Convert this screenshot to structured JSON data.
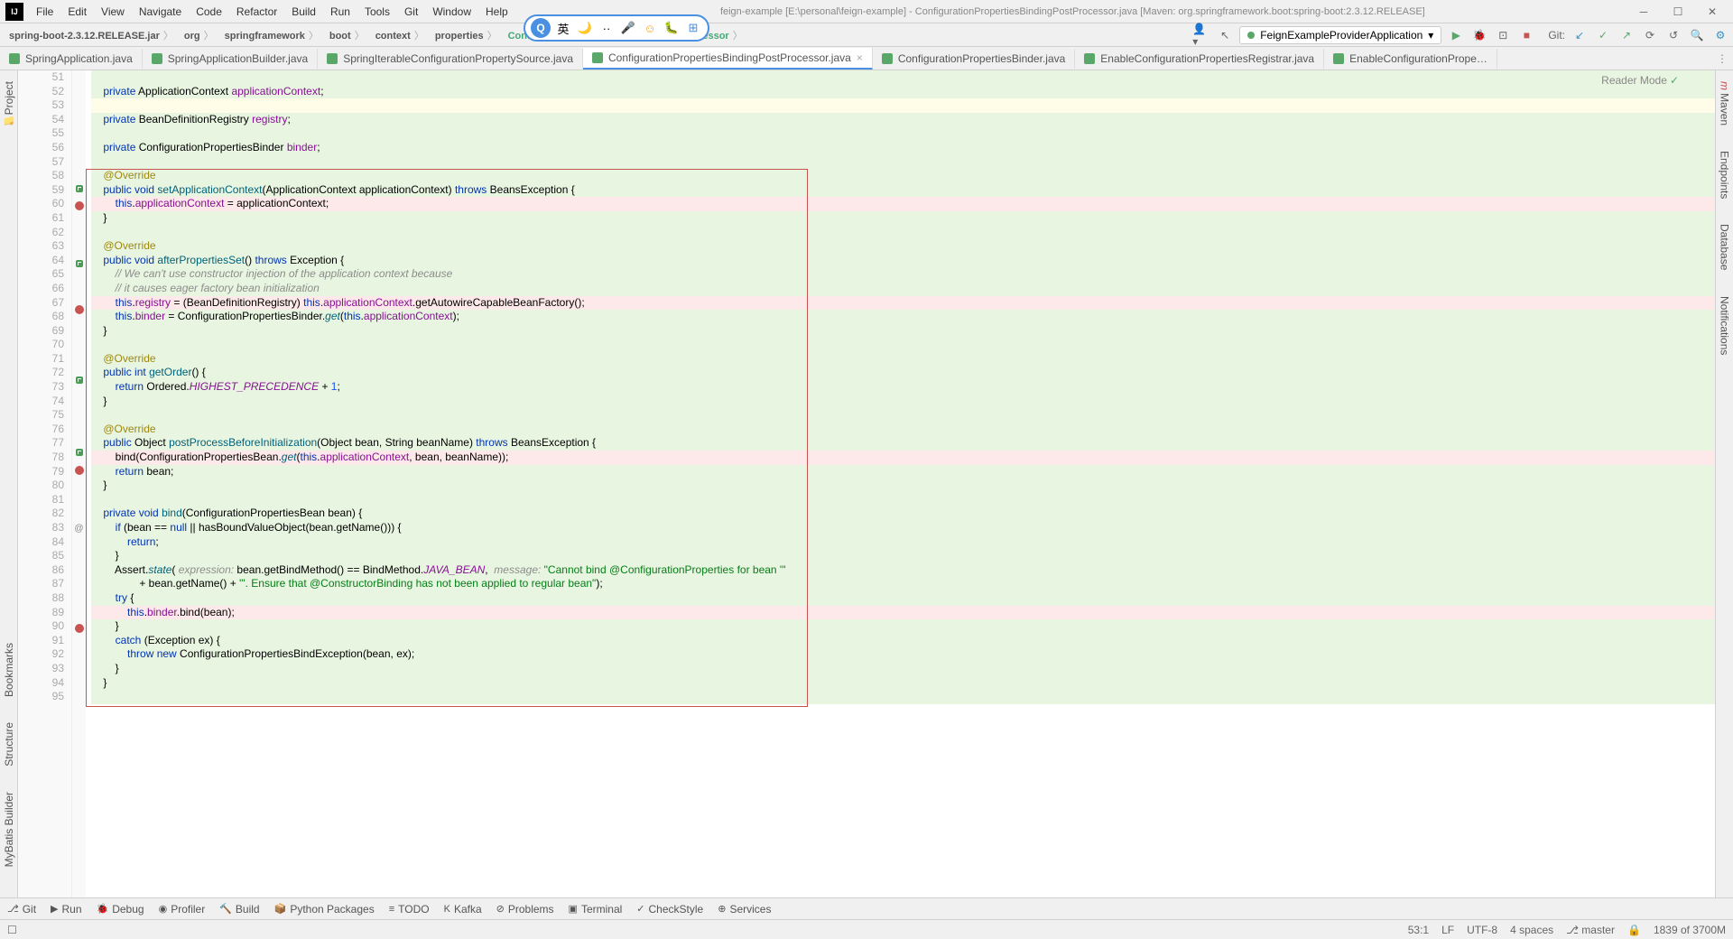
{
  "menu": [
    "File",
    "Edit",
    "View",
    "Navigate",
    "Code",
    "Refactor",
    "Build",
    "Run",
    "Tools",
    "Git",
    "Window",
    "Help"
  ],
  "title": "feign-example [E:\\personal\\feign-example] - ConfigurationPropertiesBindingPostProcessor.java [Maven: org.springframework.boot:spring-boot:2.3.12.RELEASE]",
  "breadcrumbs": [
    "spring-boot-2.3.12.RELEASE.jar",
    "org",
    "springframework",
    "boot",
    "context",
    "properties",
    "ConfigurationPropertiesBindingPostProcessor"
  ],
  "runConfig": "FeignExampleProviderApplication",
  "gitLabel": "Git:",
  "tabs": [
    {
      "label": "SpringApplication.java",
      "active": false
    },
    {
      "label": "SpringApplicationBuilder.java",
      "active": false
    },
    {
      "label": "SpringIterableConfigurationPropertySource.java",
      "active": false
    },
    {
      "label": "ConfigurationPropertiesBindingPostProcessor.java",
      "active": true
    },
    {
      "label": "ConfigurationPropertiesBinder.java",
      "active": false
    },
    {
      "label": "EnableConfigurationPropertiesRegistrar.java",
      "active": false
    },
    {
      "label": "EnableConfigurationPrope…",
      "active": false
    }
  ],
  "readerMode": "Reader Mode",
  "leftTools": [
    "Project",
    "Structure",
    "Bookmarks",
    "MyBatis Builder"
  ],
  "rightTools": [
    "Maven",
    "Endpoints",
    "Database",
    "Notifications"
  ],
  "bottomTools": [
    "Git",
    "Run",
    "Debug",
    "Profiler",
    "Build",
    "Python Packages",
    "TODO",
    "Kafka",
    "Problems",
    "Terminal",
    "CheckStyle",
    "Services"
  ],
  "status": {
    "pos": "53:1",
    "lf": "LF",
    "enc": "UTF-8",
    "indent": "4 spaces",
    "branch": "master",
    "mem": "1839 of 3700M"
  },
  "code": {
    "l51": "    private ApplicationContext applicationContext;",
    "l53": "    private BeanDefinitionRegistry registry;",
    "l56": "    private ConfigurationPropertiesBinder binder;",
    "l58": "    @Override",
    "l59": "    public void setApplicationContext(ApplicationContext applicationContext) throws BeansException {",
    "l60": "        this.applicationContext = applicationContext;",
    "l61": "    }",
    "l63": "    @Override",
    "l64": "    public void afterPropertiesSet() throws Exception {",
    "l65": "        // We can't use constructor injection of the application context because",
    "l66": "        // it causes eager factory bean initialization",
    "l67": "        this.registry = (BeanDefinitionRegistry) this.applicationContext.getAutowireCapableBeanFactory();",
    "l68": "        this.binder = ConfigurationPropertiesBinder.get(this.applicationContext);",
    "l69": "    }",
    "l71": "    @Override",
    "l72": "    public int getOrder() {",
    "l73": "        return Ordered.HIGHEST_PRECEDENCE + 1;",
    "l74": "    }",
    "l76": "    @Override",
    "l77": "    public Object postProcessBeforeInitialization(Object bean, String beanName) throws BeansException {",
    "l78": "        bind(ConfigurationPropertiesBean.get(this.applicationContext, bean, beanName));",
    "l79": "        return bean;",
    "l80": "    }",
    "l82": "    private void bind(ConfigurationPropertiesBean bean) {",
    "l83": "        if (bean == null || hasBoundValueObject(bean.getName())) {",
    "l84": "            return;",
    "l85": "        }",
    "l86a": "        Assert.state( ",
    "l86b": "expression:",
    "l86c": " bean.getBindMethod() == BindMethod.",
    "l86d": "JAVA_BEAN",
    "l86e": ",  ",
    "l86f": "message:",
    "l86g": " \"Cannot bind @ConfigurationProperties for bean '\"",
    "l87": "                + bean.getName() + \"'. Ensure that @ConstructorBinding has not been applied to regular bean\");",
    "l88": "        try {",
    "l89": "            this.binder.bind(bean);",
    "l90": "        }",
    "l91": "        catch (Exception ex) {",
    "l92": "            throw new ConfigurationPropertiesBindException(bean, ex);",
    "l93": "        }",
    "l94": "    }"
  }
}
